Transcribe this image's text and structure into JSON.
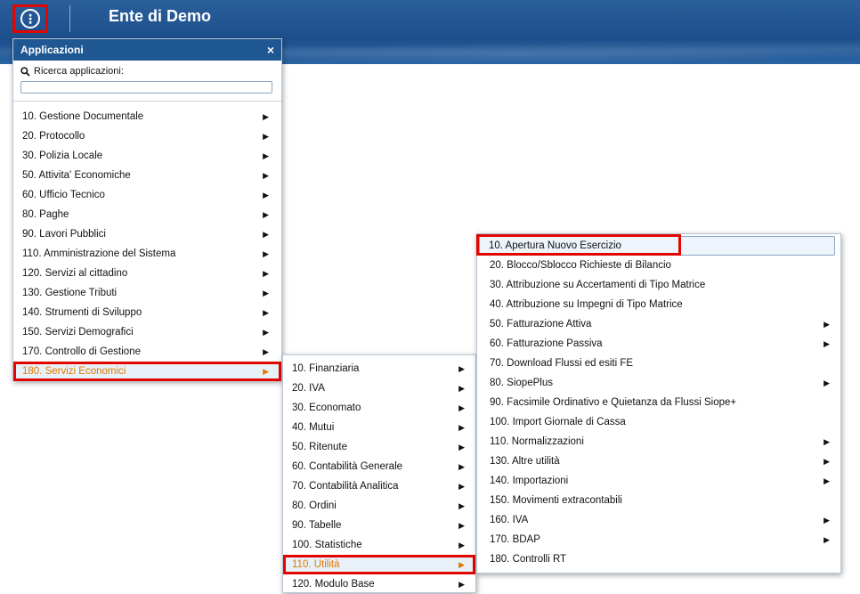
{
  "header": {
    "title": "Ente di Demo",
    "menu_icon": "vertical-dots-icon",
    "menu_glyph": "⋮"
  },
  "apps_panel": {
    "title": "Applicazioni",
    "close_glyph": "×",
    "search_label": "Ricerca applicazioni:",
    "search_value": "",
    "items": [
      {
        "label": "10. Gestione Documentale",
        "arrow": "▶"
      },
      {
        "label": "20. Protocollo",
        "arrow": "▶"
      },
      {
        "label": "30. Polizia Locale",
        "arrow": "▶"
      },
      {
        "label": "50. Attivita' Economiche",
        "arrow": "▶"
      },
      {
        "label": "60. Ufficio Tecnico",
        "arrow": "▶"
      },
      {
        "label": "80. Paghe",
        "arrow": "▶"
      },
      {
        "label": "90. Lavori Pubblici",
        "arrow": "▶"
      },
      {
        "label": "110. Amministrazione del Sistema",
        "arrow": "▶"
      },
      {
        "label": "120. Servizi al cittadino",
        "arrow": "▶"
      },
      {
        "label": "130. Gestione Tributi",
        "arrow": "▶"
      },
      {
        "label": "140. Strumenti di Sviluppo",
        "arrow": "▶"
      },
      {
        "label": "150. Servizi Demografici",
        "arrow": "▶"
      },
      {
        "label": "170. Controllo di Gestione",
        "arrow": "▶"
      },
      {
        "label": "180. Servizi Economici",
        "arrow": "▶"
      }
    ]
  },
  "servizi_economici_menu": {
    "items": [
      {
        "label": "10. Finanziaria",
        "arrow": "▶"
      },
      {
        "label": "20. IVA",
        "arrow": "▶"
      },
      {
        "label": "30. Economato",
        "arrow": "▶"
      },
      {
        "label": "40. Mutui",
        "arrow": "▶"
      },
      {
        "label": "50. Ritenute",
        "arrow": "▶"
      },
      {
        "label": "60. Contabilità Generale",
        "arrow": "▶"
      },
      {
        "label": "70. Contabilità Analitica",
        "arrow": "▶"
      },
      {
        "label": "80. Ordini",
        "arrow": "▶"
      },
      {
        "label": "90. Tabelle",
        "arrow": "▶"
      },
      {
        "label": "100. Statistiche",
        "arrow": "▶"
      },
      {
        "label": "110. Utilità",
        "arrow": "▶"
      },
      {
        "label": "120. Modulo Base",
        "arrow": "▶"
      }
    ]
  },
  "utilita_menu": {
    "items": [
      {
        "label": "10. Apertura Nuovo Esercizio",
        "arrow": ""
      },
      {
        "label": "20. Blocco/Sblocco Richieste di Bilancio",
        "arrow": ""
      },
      {
        "label": "30. Attribuzione su Accertamenti di Tipo Matrice",
        "arrow": ""
      },
      {
        "label": "40. Attribuzione su Impegni di Tipo Matrice",
        "arrow": ""
      },
      {
        "label": "50. Fatturazione Attiva",
        "arrow": "▶"
      },
      {
        "label": "60. Fatturazione Passiva",
        "arrow": "▶"
      },
      {
        "label": "70. Download Flussi ed esiti FE",
        "arrow": ""
      },
      {
        "label": "80. SiopePlus",
        "arrow": "▶"
      },
      {
        "label": "90. Facsimile Ordinativo e Quietanza da Flussi Siope+",
        "arrow": ""
      },
      {
        "label": "100. Import Giornale di Cassa",
        "arrow": ""
      },
      {
        "label": "110. Normalizzazioni",
        "arrow": "▶"
      },
      {
        "label": "130. Altre utilità",
        "arrow": "▶"
      },
      {
        "label": "140. Importazioni",
        "arrow": "▶"
      },
      {
        "label": "150. Movimenti extracontabili",
        "arrow": ""
      },
      {
        "label": "160. IVA",
        "arrow": "▶"
      },
      {
        "label": "170. BDAP",
        "arrow": "▶"
      },
      {
        "label": "180. Controlli RT",
        "arrow": ""
      }
    ]
  },
  "colors": {
    "header": "#1f5793",
    "highlight_box": "#e10600",
    "active_text": "#e07b00"
  }
}
